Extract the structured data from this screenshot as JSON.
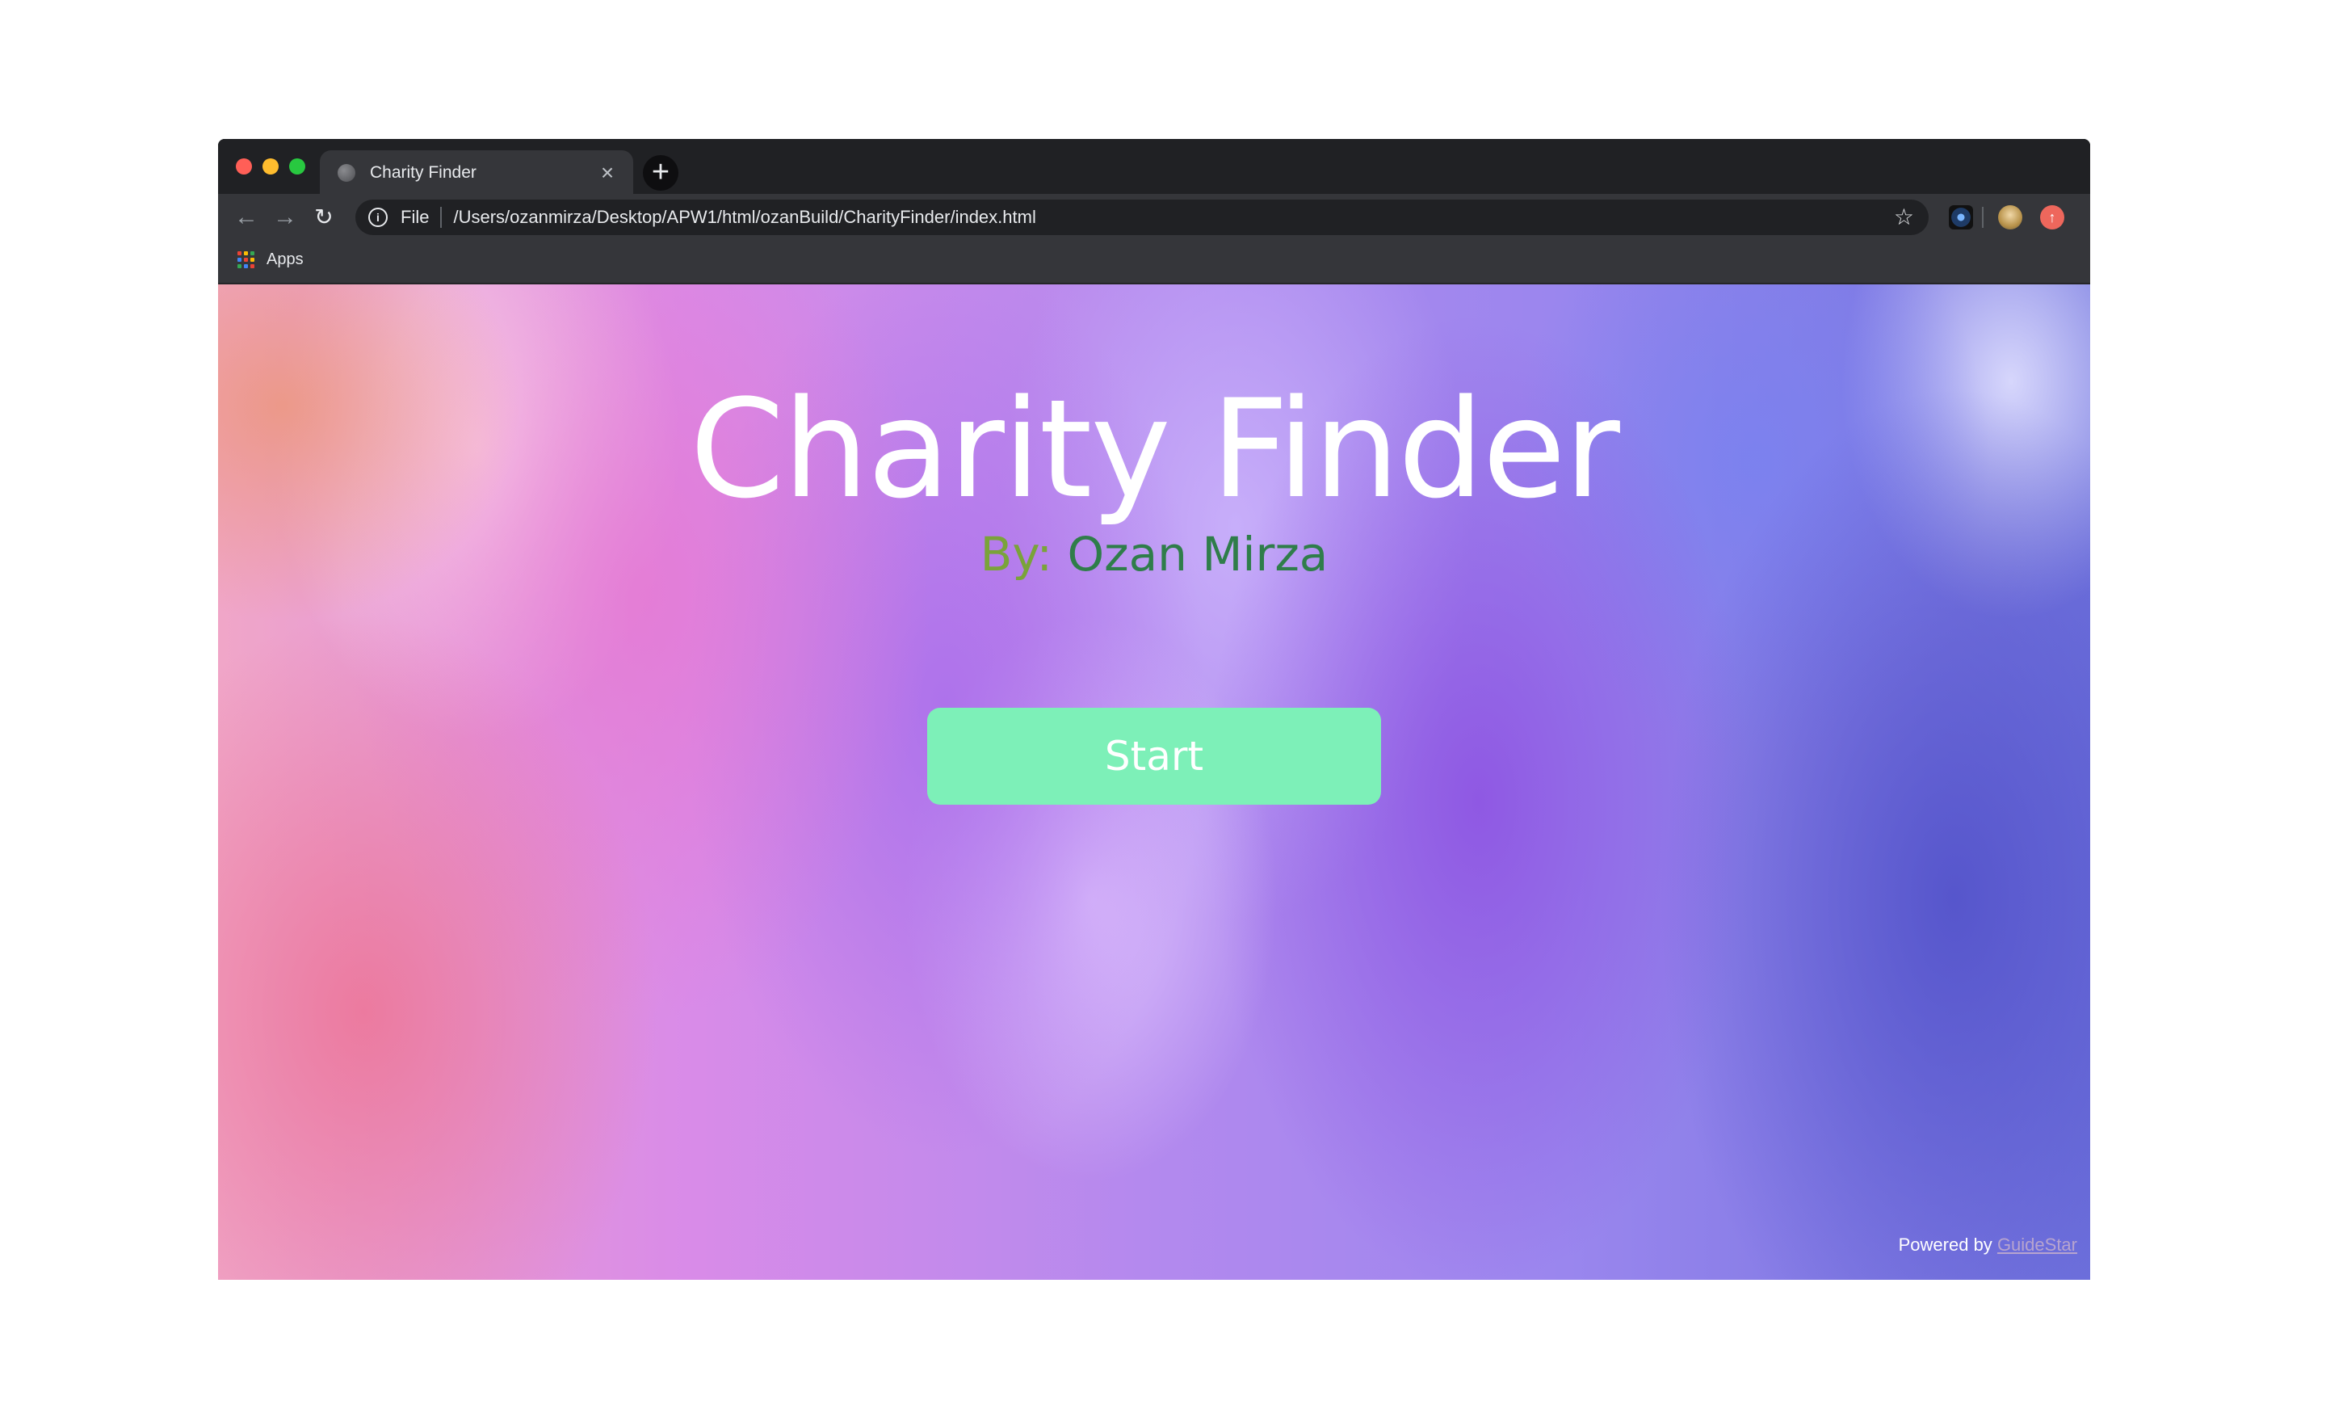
{
  "browser": {
    "tab_title": "Charity Finder",
    "tab_close": "×",
    "new_tab": "+",
    "scheme_label": "File",
    "url": "/Users/ozanmirza/Desktop/APW1/html/ozanBuild/CharityFinder/index.html",
    "bookmark_apps_label": "Apps",
    "icons": {
      "back": "arrow-left-icon",
      "forward": "arrow-right-icon",
      "reload": "reload-icon",
      "info": "info-icon",
      "bookmark": "star-icon",
      "extension": "extension-icon",
      "profile": "profile-avatar-icon",
      "update": "update-icon"
    }
  },
  "page": {
    "title": "Charity Finder",
    "byline_prefix": "By:",
    "byline_name": "Ozan Mirza",
    "start_label": "Start",
    "powered_by_prefix": "Powered by",
    "powered_by_link": "GuideStar",
    "colors": {
      "start_button": "#7df0b8",
      "byline_prefix": "#7aa33a",
      "byline_name": "#2f7d4a"
    }
  }
}
